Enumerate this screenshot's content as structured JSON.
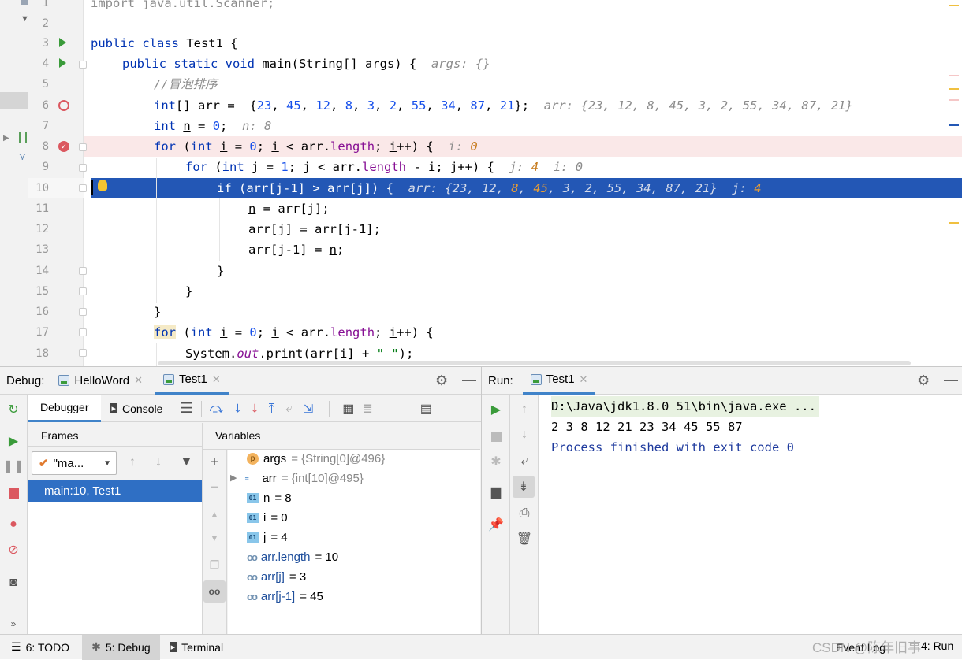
{
  "editor": {
    "lines": [
      {
        "num": "1"
      },
      {
        "num": "2"
      },
      {
        "num": "3"
      },
      {
        "num": "4"
      },
      {
        "num": "5"
      },
      {
        "num": "6"
      },
      {
        "num": "7"
      },
      {
        "num": "8"
      },
      {
        "num": "9"
      },
      {
        "num": "10"
      },
      {
        "num": "11"
      },
      {
        "num": "12"
      },
      {
        "num": "13"
      },
      {
        "num": "14"
      },
      {
        "num": "15"
      },
      {
        "num": "16"
      },
      {
        "num": "17"
      },
      {
        "num": "18"
      }
    ],
    "code": {
      "l1": "import java.util.Scanner;",
      "l3_kw": "public class",
      "l3_rest": " Test1 {",
      "l4_kw": "public static void",
      "l4_rest": " main(String[] args) {",
      "l4_hint": "args: {}",
      "l5_comment": "//冒泡排序",
      "l6_kw": "int",
      "l6_a": "[] arr =  {",
      "l6_nums": [
        "23",
        "45",
        "12",
        "8",
        "3",
        "2",
        "55",
        "34",
        "87",
        "21"
      ],
      "l6_hint": "arr: {23, 12, 8, 45, 3, 2, 55, 34, 87, 21}",
      "l7_kw": "int",
      "l7_var": "n",
      "l7_eq": " = ",
      "l7_num": "0",
      "l7_semi": ";",
      "l7_hint": "n: 8",
      "l8_kw1": "for",
      "l8_a": " (",
      "l8_kw2": "int",
      "l8_b": " ",
      "l8_var": "i",
      "l8_c": " = ",
      "l8_num": "0",
      "l8_d": "; ",
      "l8_var2": "i",
      "l8_e": " < arr.",
      "l8_fld": "length",
      "l8_f": "; ",
      "l8_var3": "i",
      "l8_g": "++) {",
      "l8_hint_k": "i: ",
      "l8_hint_v": "0",
      "l9_kw1": "for",
      "l9_a": " (",
      "l9_kw2": "int",
      "l9_b": " j = ",
      "l9_num": "1",
      "l9_c": "; j < arr.",
      "l9_fld": "length",
      "l9_d": " - ",
      "l9_var": "i",
      "l9_e": "; j++) {",
      "l9_hint_j": "j: ",
      "l9_hint_jv": "4",
      "l9_hint_i": "i: 0",
      "l10": "if (arr[j-1] > arr[j]) {",
      "l10_hint_a": "arr: {23, 12, ",
      "l10_hint_8": "8",
      "l10_hint_c": ", ",
      "l10_hint_45": "45",
      "l10_hint_d": ", 3, 2, 55, 34, 87, 21}",
      "l10_hint_j": "j: ",
      "l10_hint_jv": "4",
      "l11_var": "n",
      "l11_rest": " = arr[j];",
      "l12": "arr[j] = arr[j-1];",
      "l13_a": "arr[j-1] = ",
      "l13_var": "n",
      "l13_b": ";",
      "l14": "}",
      "l15": "}",
      "l16": "}",
      "l17_kw1": "for",
      "l17_a": " (",
      "l17_kw2": "int",
      "l17_b": " ",
      "l17_var": "i",
      "l17_c": " = ",
      "l17_num": "0",
      "l17_d": "; ",
      "l17_var2": "i",
      "l17_e": " < arr.",
      "l17_fld": "length",
      "l17_f": "; ",
      "l17_var3": "i",
      "l17_g": "++) {",
      "l18_a": "System.",
      "l18_fld": "out",
      "l18_b": ".print(arr[i] + ",
      "l18_str": "\" \"",
      "l18_c": ");"
    }
  },
  "debug": {
    "title": "Debug:",
    "tabs": [
      {
        "label": "HelloWord"
      },
      {
        "label": "Test1"
      }
    ],
    "subtabs": {
      "debugger": "Debugger",
      "console": "Console"
    },
    "frames_label": "Frames",
    "thread_select": "\"ma...",
    "frame_item": "main:10, Test1",
    "variables_label": "Variables",
    "variables": [
      {
        "name": "args",
        "val": "= {String[0]@496}"
      },
      {
        "name": "arr",
        "val": "= {int[10]@495}"
      },
      {
        "name": "n",
        "val": "= 8"
      },
      {
        "name": "i",
        "val": "= 0"
      },
      {
        "name": "j",
        "val": "= 4"
      },
      {
        "name": "arr.length",
        "val": "= 10"
      },
      {
        "name": "arr[j]",
        "val": "= 3"
      },
      {
        "name": "arr[j-1]",
        "val": "= 45"
      }
    ]
  },
  "run": {
    "title": "Run:",
    "tab": "Test1",
    "console": {
      "line1": "D:\\Java\\jdk1.8.0_51\\bin\\java.exe ...",
      "line2": "2 3 8 12 21 23 34 45 55 87",
      "line3": "Process finished with exit code 0"
    }
  },
  "statusbar": {
    "todo": "6: TODO",
    "debug": "5: Debug",
    "terminal": "Terminal",
    "watermark": "CSDN @陈年旧事",
    "eventlog": "Event Log",
    "run": "4: Run"
  },
  "colors": {
    "accent": "#2357b5",
    "breakpoint": "#db5860",
    "run": "#3a9b3a"
  }
}
